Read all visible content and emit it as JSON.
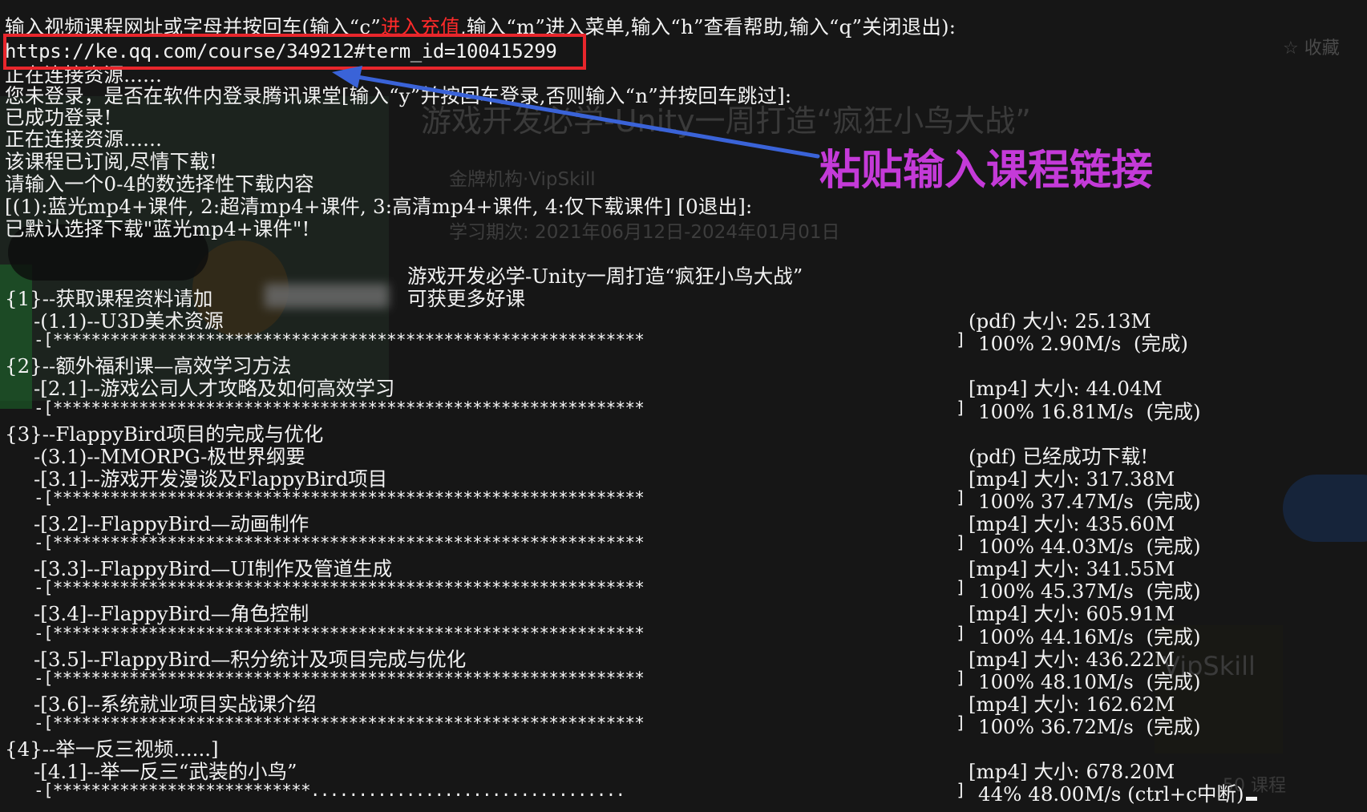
{
  "background_page": {
    "title": "游戏开发必学-Unity一周打造“疯狂小鸟大战”",
    "org": "金牌机构·VipSkill",
    "period": "学习期次: 2021年06月12日-2024年01月01日",
    "favorite": "☆ 收藏",
    "brand": "VipSkill",
    "course_count": "50 课程"
  },
  "terminal": {
    "prompt_prefix": "输入视频课程网址或字母并按回车(输入“c”",
    "prompt_highlight": "进入充值",
    "prompt_suffix": ",输入“m”进入菜单,输入“h”查看帮助,输入“q”关闭退出):",
    "url_input": "https://ke.qq.com/course/349212#term_id=100415299",
    "connecting_1": "正在连接资源......",
    "login_prompt": "您未登录，是否在软件内登录腾讯课堂[输入“y”并按回车登录,否则输入“n”并按回车跳过]:",
    "login_success": "已成功登录!",
    "connecting_2": "正在连接资源......",
    "subscribed": "该课程已订阅,尽情下载!",
    "select_prompt": "请输入一个0-4的数选择性下载内容",
    "options": "[(1):蓝光mp4+课件, 2:超清mp4+课件, 3:高清mp4+课件, 4:仅下载课件] [0退出]:",
    "default_choice": "已默认选择下载\"蓝光mp4+课件\"!",
    "course_title": "游戏开发必学-Unity一周打造“疯狂小鸟大战”",
    "course_subtitle": "可获更多好课"
  },
  "sections": [
    {
      "title": "{1}--获取课程资料请加",
      "items": [
        {
          "name": "-(1.1)--U3D美术资源",
          "meta": "(pdf) 大小: 25.13M",
          "bar": "-[**************************************************************",
          "stat": "100% 2.90M/s  (完成)"
        }
      ]
    },
    {
      "title": "{2}--额外福利课—高效学习方法",
      "items": [
        {
          "name": "-[2.1]--游戏公司人才攻略及如何高效学习",
          "meta": "[mp4] 大小: 44.04M",
          "bar": "-[**************************************************************",
          "stat": "100% 16.81M/s  (完成)"
        }
      ]
    },
    {
      "title": "{3}--FlappyBird项目的完成与优化",
      "items": [
        {
          "name": "-(3.1)--MMORPG-极世界纲要",
          "meta": "(pdf) 已经成功下载!",
          "bar": "",
          "stat": ""
        },
        {
          "name": "-[3.1]--游戏开发漫谈及FlappyBird项目",
          "meta": "[mp4] 大小: 317.38M",
          "bar": "-[**************************************************************",
          "stat": "100% 37.47M/s  (完成)"
        },
        {
          "name": "-[3.2]--FlappyBird—动画制作",
          "meta": "[mp4] 大小: 435.60M",
          "bar": "-[**************************************************************",
          "stat": "100% 44.03M/s  (完成)"
        },
        {
          "name": "-[3.3]--FlappyBird—UI制作及管道生成",
          "meta": "[mp4] 大小: 341.55M",
          "bar": "-[**************************************************************",
          "stat": "100% 45.37M/s  (完成)"
        },
        {
          "name": "-[3.4]--FlappyBird—角色控制",
          "meta": "[mp4] 大小: 605.91M",
          "bar": "-[**************************************************************",
          "stat": "100% 44.16M/s  (完成)"
        },
        {
          "name": "-[3.5]--FlappyBird—积分统计及项目完成与优化",
          "meta": "[mp4] 大小: 436.22M",
          "bar": "-[**************************************************************",
          "stat": "100% 48.10M/s  (完成)"
        },
        {
          "name": "-[3.6]--系统就业项目实战课介绍",
          "meta": "[mp4] 大小: 162.62M",
          "bar": "-[**************************************************************",
          "stat": "100% 36.72M/s  (完成)"
        }
      ]
    },
    {
      "title": "{4}--举一反三视频......]",
      "items": [
        {
          "name": "-[4.1]--举一反三“武装的小鸟”",
          "meta": "[mp4] 大小: 678.20M",
          "bar": "-[***************************.................................",
          "stat": "44% 48.00M/s (ctrl+c中断)"
        }
      ]
    }
  ],
  "annotation": {
    "text": "粘贴输入课程链接",
    "color": "#c43ad8",
    "box_color": "#e8262c",
    "arrow_color": "#3a63d8"
  }
}
